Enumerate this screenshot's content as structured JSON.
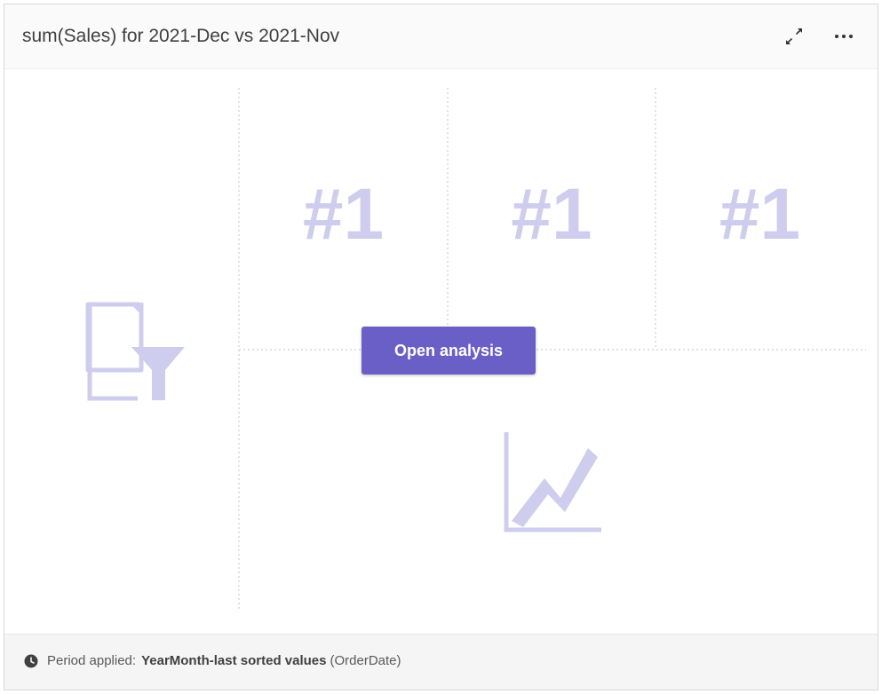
{
  "title": "sum(Sales) for 2021-Dec vs 2021-Nov",
  "placeholder": {
    "kpi_labels": [
      "#1",
      "#1",
      "#1"
    ],
    "colors": {
      "placeholder": "#cfcdee",
      "accent": "#6a5fc6"
    }
  },
  "open_button": {
    "label": "Open analysis"
  },
  "header_icons": [
    "expand-icon",
    "more-options-icon"
  ],
  "footer": {
    "label": "Period applied:",
    "value": "YearMonth-last sorted values",
    "suffix": "(OrderDate)",
    "icon": "clock-icon"
  }
}
